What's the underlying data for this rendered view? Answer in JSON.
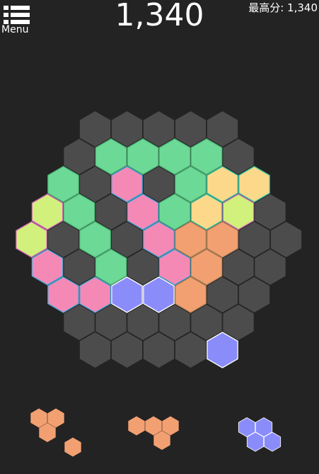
{
  "header": {
    "menu_label": "Menu",
    "score": "1,340",
    "best_label": "最高分",
    "best_value": "1,340",
    "best_text": "最高分: 1,340"
  },
  "board": {
    "empty_color": "#4c4c4c",
    "radius": 4,
    "rows": [
      [
        "empty",
        "empty",
        "empty",
        "empty",
        "empty"
      ],
      [
        "empty",
        "green",
        "green",
        "green",
        "green",
        "empty"
      ],
      [
        "green",
        "empty",
        "pink",
        "empty",
        "green",
        "yellow",
        "yellow"
      ],
      [
        "lime",
        "green",
        "empty",
        "pink",
        "green",
        "yellow",
        "lime",
        "empty"
      ],
      [
        "lime",
        "empty",
        "green",
        "empty",
        "pink",
        "orange",
        "orange",
        "empty",
        "empty"
      ],
      [
        "pink",
        "empty",
        "green",
        "empty",
        "pink",
        "orange",
        "empty",
        "empty"
      ],
      [
        "pink",
        "pink",
        "blue",
        "blue",
        "orange",
        "empty",
        "empty"
      ],
      [
        "empty",
        "empty",
        "empty",
        "empty",
        "empty",
        "empty"
      ],
      [
        "empty",
        "empty",
        "empty",
        "empty",
        "blue"
      ]
    ]
  },
  "colors": {
    "empty": {
      "fill": "#4c4c4c",
      "stroke": "#4c4c4c"
    },
    "green": {
      "fill": "#6dd996",
      "stroke": "#50b87a"
    },
    "pink": {
      "fill": "#f589b6",
      "stroke": "#4aa6d6"
    },
    "yellow": {
      "fill": "#fcd98a",
      "stroke": "#3fc9a6"
    },
    "lime": {
      "fill": "#d2f07c",
      "stroke": "#d46ab5"
    },
    "orange": {
      "fill": "#f2a072",
      "stroke": "#c08a5a"
    },
    "blue": {
      "fill": "#8a8cfa",
      "stroke": "#ffffff"
    }
  },
  "pieces": [
    {
      "name": "piece-1",
      "color": "orange",
      "cells": [
        [
          0,
          0
        ],
        [
          1,
          0
        ],
        [
          0,
          1
        ],
        [
          1,
          2
        ]
      ]
    },
    {
      "name": "piece-2",
      "color": "orange",
      "cells": [
        [
          0,
          0
        ],
        [
          1,
          0
        ],
        [
          2,
          0
        ],
        [
          1,
          1
        ]
      ]
    },
    {
      "name": "piece-3",
      "color": "blue",
      "cells": [
        [
          0,
          0
        ],
        [
          1,
          0
        ],
        [
          0,
          1
        ],
        [
          1,
          1
        ]
      ]
    }
  ]
}
